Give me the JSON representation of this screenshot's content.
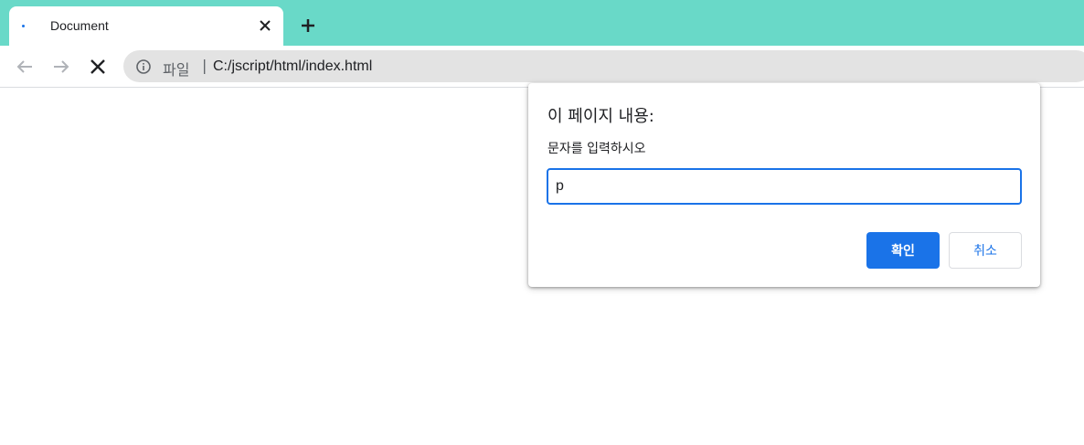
{
  "browser": {
    "tab_title": "Document",
    "tabstrip_color": "#69d9c8",
    "url_scheme_label": "파일",
    "url_separator": "|",
    "url": "C:/jscript/html/index.html",
    "icons": {
      "tab_close": "close-icon",
      "new_tab": "plus-icon",
      "back": "arrow-left-icon",
      "forward": "arrow-right-icon",
      "stop": "close-icon",
      "site_info": "info-icon"
    }
  },
  "dialog": {
    "title": "이 페이지 내용:",
    "message": "문자를 입력하시오",
    "input_value": "p",
    "ok_label": "확인",
    "cancel_label": "취소",
    "accent_color": "#1a73e8"
  }
}
